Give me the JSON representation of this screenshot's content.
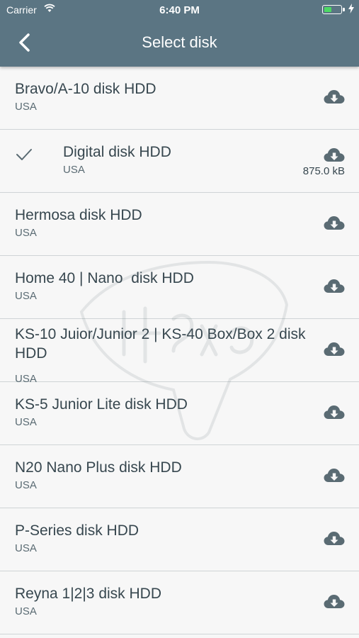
{
  "status_bar": {
    "carrier": "Carrier",
    "time": "6:40 PM"
  },
  "header": {
    "title": "Select disk",
    "back_icon": "chevron-left-icon"
  },
  "disks": [
    {
      "name": "Bravo/A-10 disk HDD",
      "country": "USA",
      "selected": false,
      "icon": "cloud-download-icon"
    },
    {
      "name": "Digital disk HDD",
      "country": "USA",
      "selected": true,
      "size": "875.0 kB",
      "icon": "cloud-download-icon"
    },
    {
      "name": "Hermosa disk HDD",
      "country": "USA",
      "selected": false,
      "icon": "cloud-download-icon"
    },
    {
      "name": "Home 40 | Nano  disk HDD",
      "country": "USA",
      "selected": false,
      "icon": "cloud-download-icon"
    },
    {
      "name": "KS-10 Juior/Junior 2 | KS-40 Box/Box 2 disk HDD",
      "country": "USA",
      "selected": false,
      "icon": "cloud-download-icon"
    },
    {
      "name": "KS-5 Junior Lite disk HDD",
      "country": "USA",
      "selected": false,
      "icon": "cloud-download-icon"
    },
    {
      "name": "N20 Nano Plus disk HDD",
      "country": "USA",
      "selected": false,
      "icon": "cloud-download-icon"
    },
    {
      "name": "P-Series disk HDD",
      "country": "USA",
      "selected": false,
      "icon": "cloud-download-icon"
    },
    {
      "name": "Reyna 1|2|3 disk HDD",
      "country": "USA",
      "selected": false,
      "icon": "cloud-download-icon"
    }
  ],
  "colors": {
    "header": "#5b7583",
    "text": "#37474f",
    "icon": "#5a6b73",
    "battery": "#4cd964"
  }
}
